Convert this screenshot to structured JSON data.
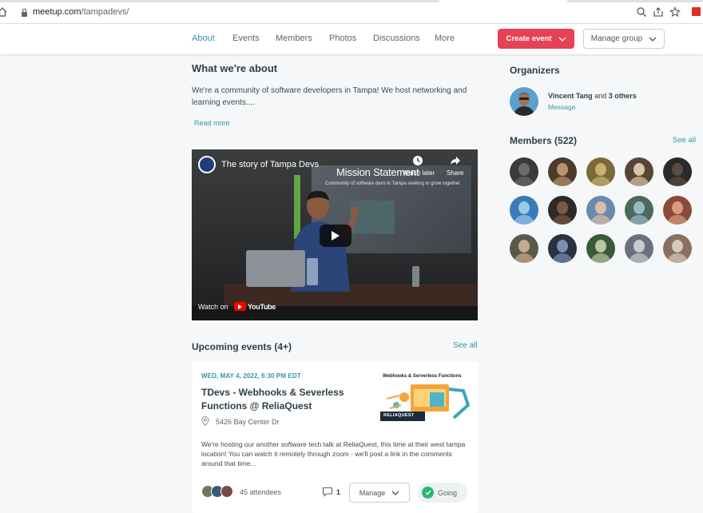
{
  "browser": {
    "url_host": "meetup.com",
    "url_path": "/tampadevs/"
  },
  "nav": {
    "links": [
      "About",
      "Events",
      "Members",
      "Photos",
      "Discussions",
      "More"
    ],
    "create_event": "Create event",
    "manage_group": "Manage group"
  },
  "about": {
    "heading": "What we're about",
    "text": "We're a community of software developers in Tampa! We host networking and learning events....",
    "read_more": "Read more"
  },
  "video": {
    "title": "The story of Tampa Devs",
    "slide_heading": "Mission Statement",
    "slide_sub": "Community of software devs in Tampa seeking to grow together",
    "watch_later": "Watch later",
    "share": "Share",
    "watch_on": "Watch on",
    "youtube": "YouTube"
  },
  "upcoming": {
    "heading": "Upcoming events (4+)",
    "see_all": "See all",
    "event": {
      "date": "WED, MAY 4, 2022, 6:30 PM EDT",
      "title": "TDevs - Webhooks & Severless Functions @ ReliaQuest",
      "location": "5426 Bay Center Dr",
      "thumb_title": "Webhooks & Serverless Functions",
      "thumb_brand": "RELIAQUEST",
      "description": "We're hosting our another software tech talk at ReliaQuest, this time at their west tampa location! You can watch it remotely through zoom - we'll post a link in the comments around that time...",
      "attendees": "45 attendees",
      "comments": "1",
      "manage": "Manage",
      "going": "Going"
    }
  },
  "organizers": {
    "heading": "Organizers",
    "name": "Vincent Tang",
    "and": "and",
    "others": "3 others",
    "message": "Message"
  },
  "members": {
    "heading": "Members (522)",
    "see_all": "See all",
    "avatar_colors": [
      [
        "#3a3a3a",
        "#6b6b6b"
      ],
      [
        "#4a3b2c",
        "#b9946a"
      ],
      [
        "#7a6a3a",
        "#c9b070"
      ],
      [
        "#5a4535",
        "#d8c4a8"
      ],
      [
        "#2a2a2a",
        "#5a4a40"
      ],
      [
        "#3a7ab8",
        "#9ac8e8"
      ],
      [
        "#2e2a28",
        "#7a5a45"
      ],
      [
        "#6a8ab0",
        "#d8c0a8"
      ],
      [
        "#4a6a5a",
        "#9ab8c8"
      ],
      [
        "#8a4a3a",
        "#d89a80"
      ],
      [
        "#5a5a4a",
        "#c8a890"
      ],
      [
        "#2a3040",
        "#7a90b0"
      ],
      [
        "#3a5a3a",
        "#b8c8a0"
      ],
      [
        "#6a7080",
        "#c8ccd0"
      ],
      [
        "#8a7060",
        "#d8c8b8"
      ]
    ]
  },
  "colors": {
    "accent_teal": "#2d9aa3",
    "nav_active": "#3d8fb8",
    "create_red": "#e64155",
    "going_green": "#2bb673"
  }
}
